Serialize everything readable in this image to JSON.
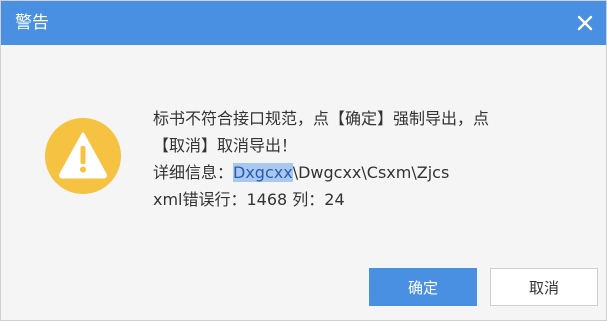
{
  "dialog": {
    "title": "警告",
    "close_icon": "close-icon",
    "warning_icon": "warning-icon",
    "message": {
      "line1": "标书不符合接口规范，点【确定】强制导出，点",
      "line2": "【取消】取消导出！",
      "detail_label": "详细信息：",
      "path_highlight": "Dxgcxx",
      "path_rest": "\\Dwgcxx\\Csxm\\Zjcs",
      "line4": "xml错误行：1468 列：24"
    },
    "buttons": {
      "ok_label": "确定",
      "cancel_label": "取消"
    },
    "colors": {
      "titlebar": "#4a90e2",
      "icon": "#f5c242",
      "primary_button": "#4a90e2"
    }
  }
}
